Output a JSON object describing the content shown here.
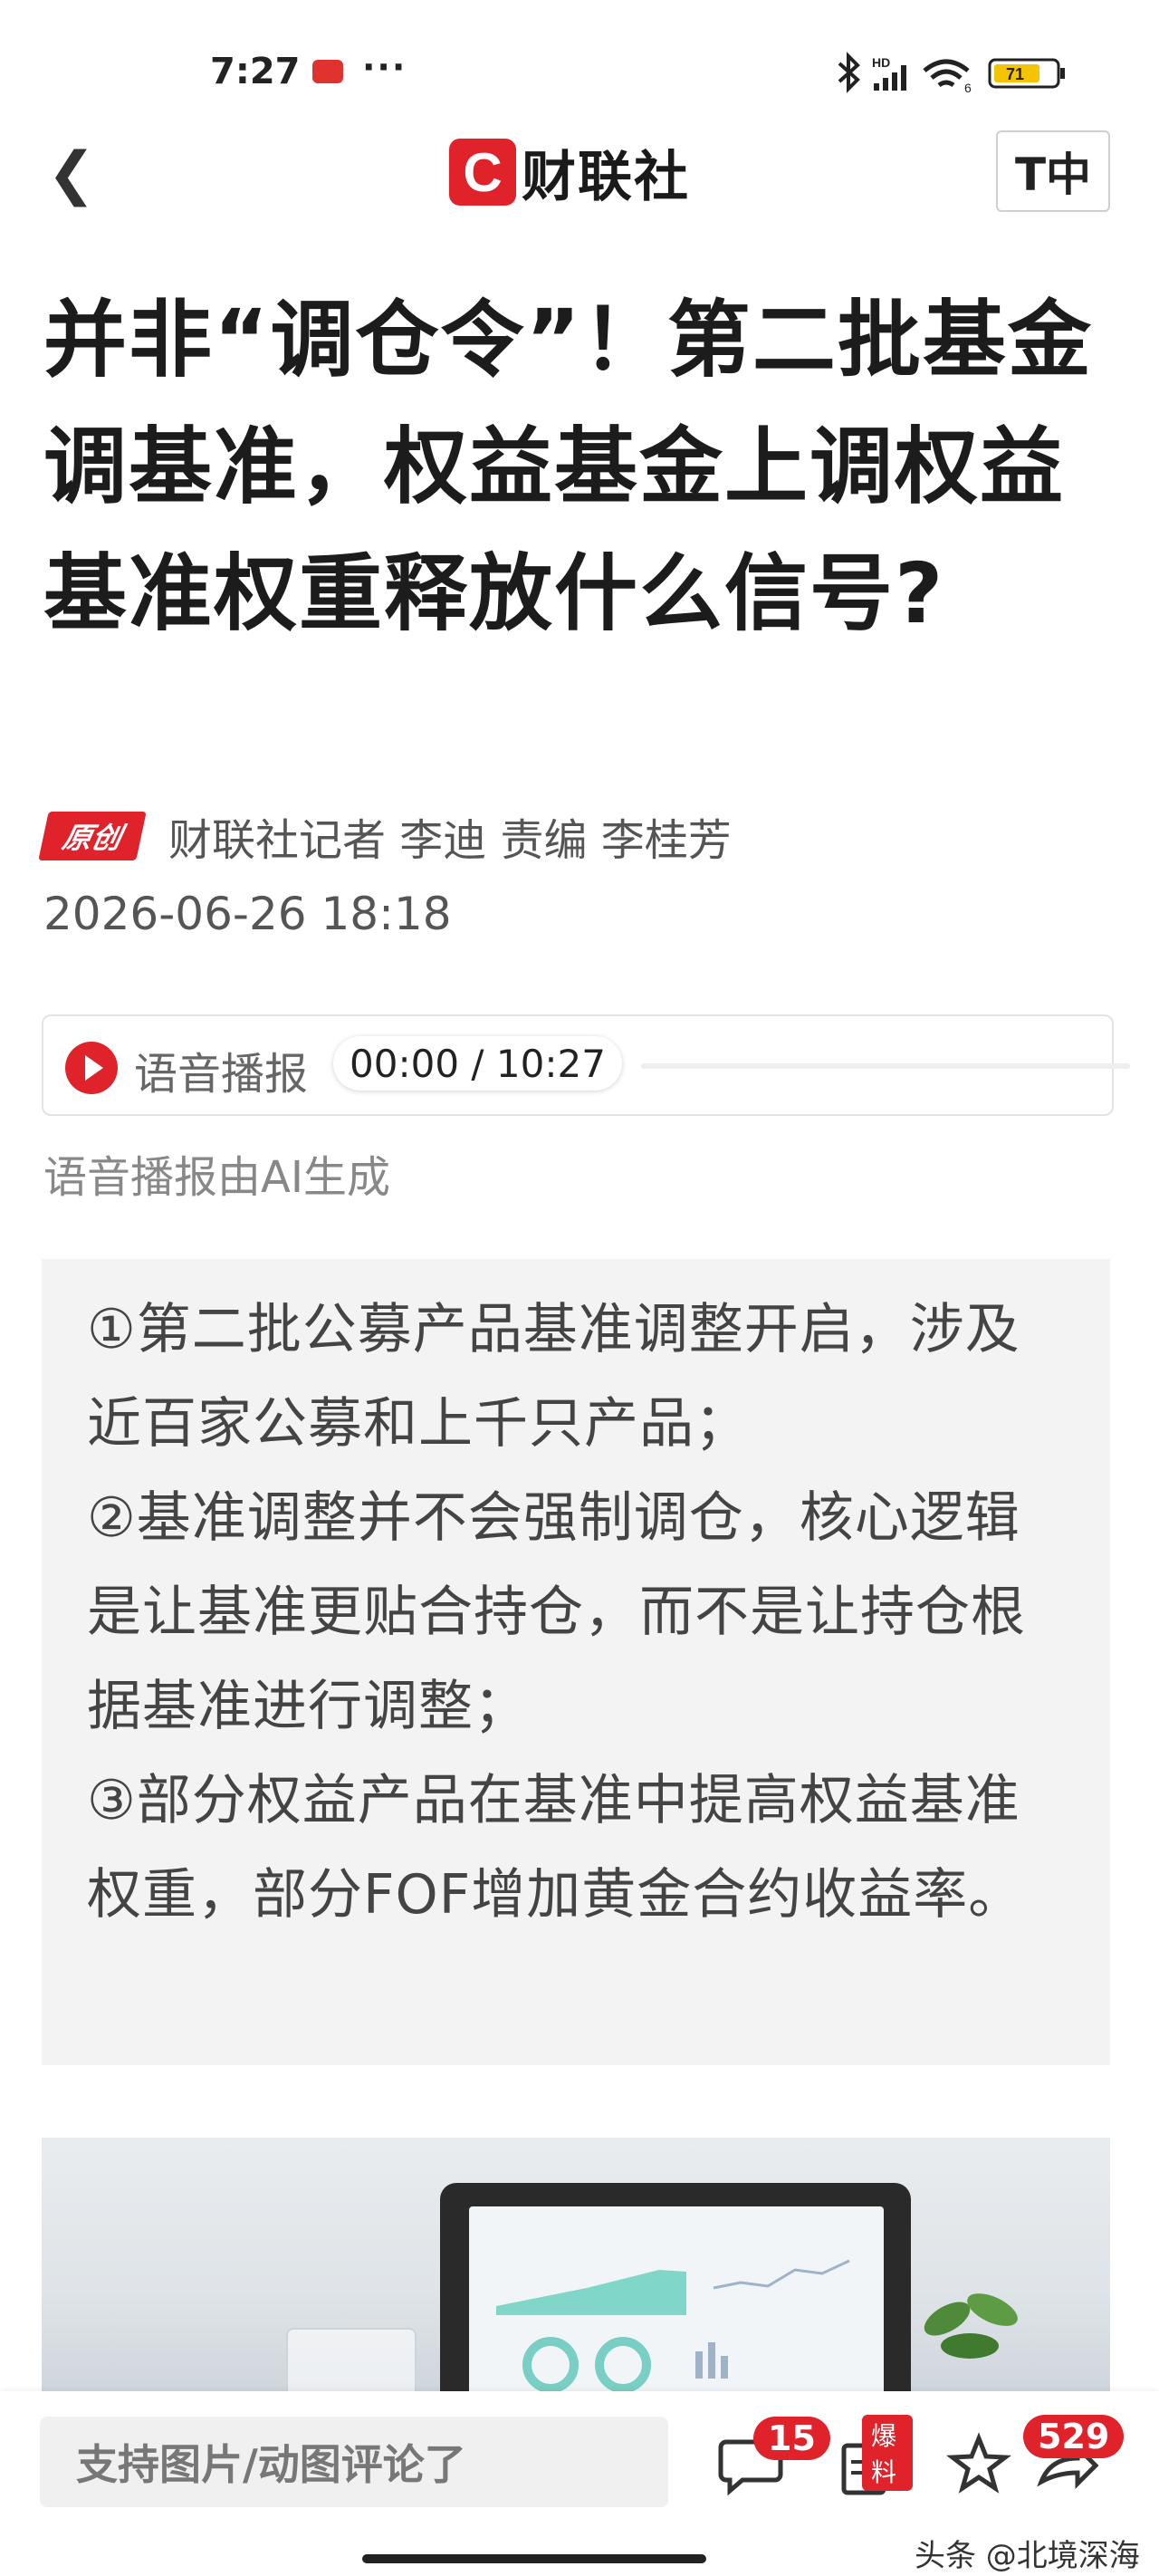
{
  "status": {
    "time": "7:27",
    "battery": "71",
    "network": "HD",
    "wifi_sub": "6"
  },
  "nav": {
    "logo_letter": "C",
    "logo_text": "财联社",
    "font_button": "T中"
  },
  "article": {
    "title": "并非“调仓令”！第二批基金调基准，权益基金上调权益基准权重释放什么信号?",
    "original_tag": "原创",
    "byline": "财联社记者 李迪 责编 李桂芳",
    "date": "2026-06-26 18:18"
  },
  "audio": {
    "label": "语音播报",
    "time": "00:00 / 10:27",
    "note": "语音播报由AI生成"
  },
  "summary": [
    "①第二批公募产品基准调整开启，涉及近百家公募和上千只产品；",
    "②基准调整并不会强制调仓，核心逻辑是让基准更贴合持仓，而不是让持仓根据基准进行调整；",
    "③部分权益产品在基准中提高权益基准权重，部分FOF增加黄金合约收益率。"
  ],
  "bottom": {
    "comment_placeholder": "支持图片/动图评论了",
    "comments_count": "15",
    "tip_tag": "爆料",
    "share_count": "529"
  },
  "watermark": "头条 @北境深海",
  "colors": {
    "brand_red": "#e0222a",
    "summary_bg": "#f3f3f3"
  }
}
